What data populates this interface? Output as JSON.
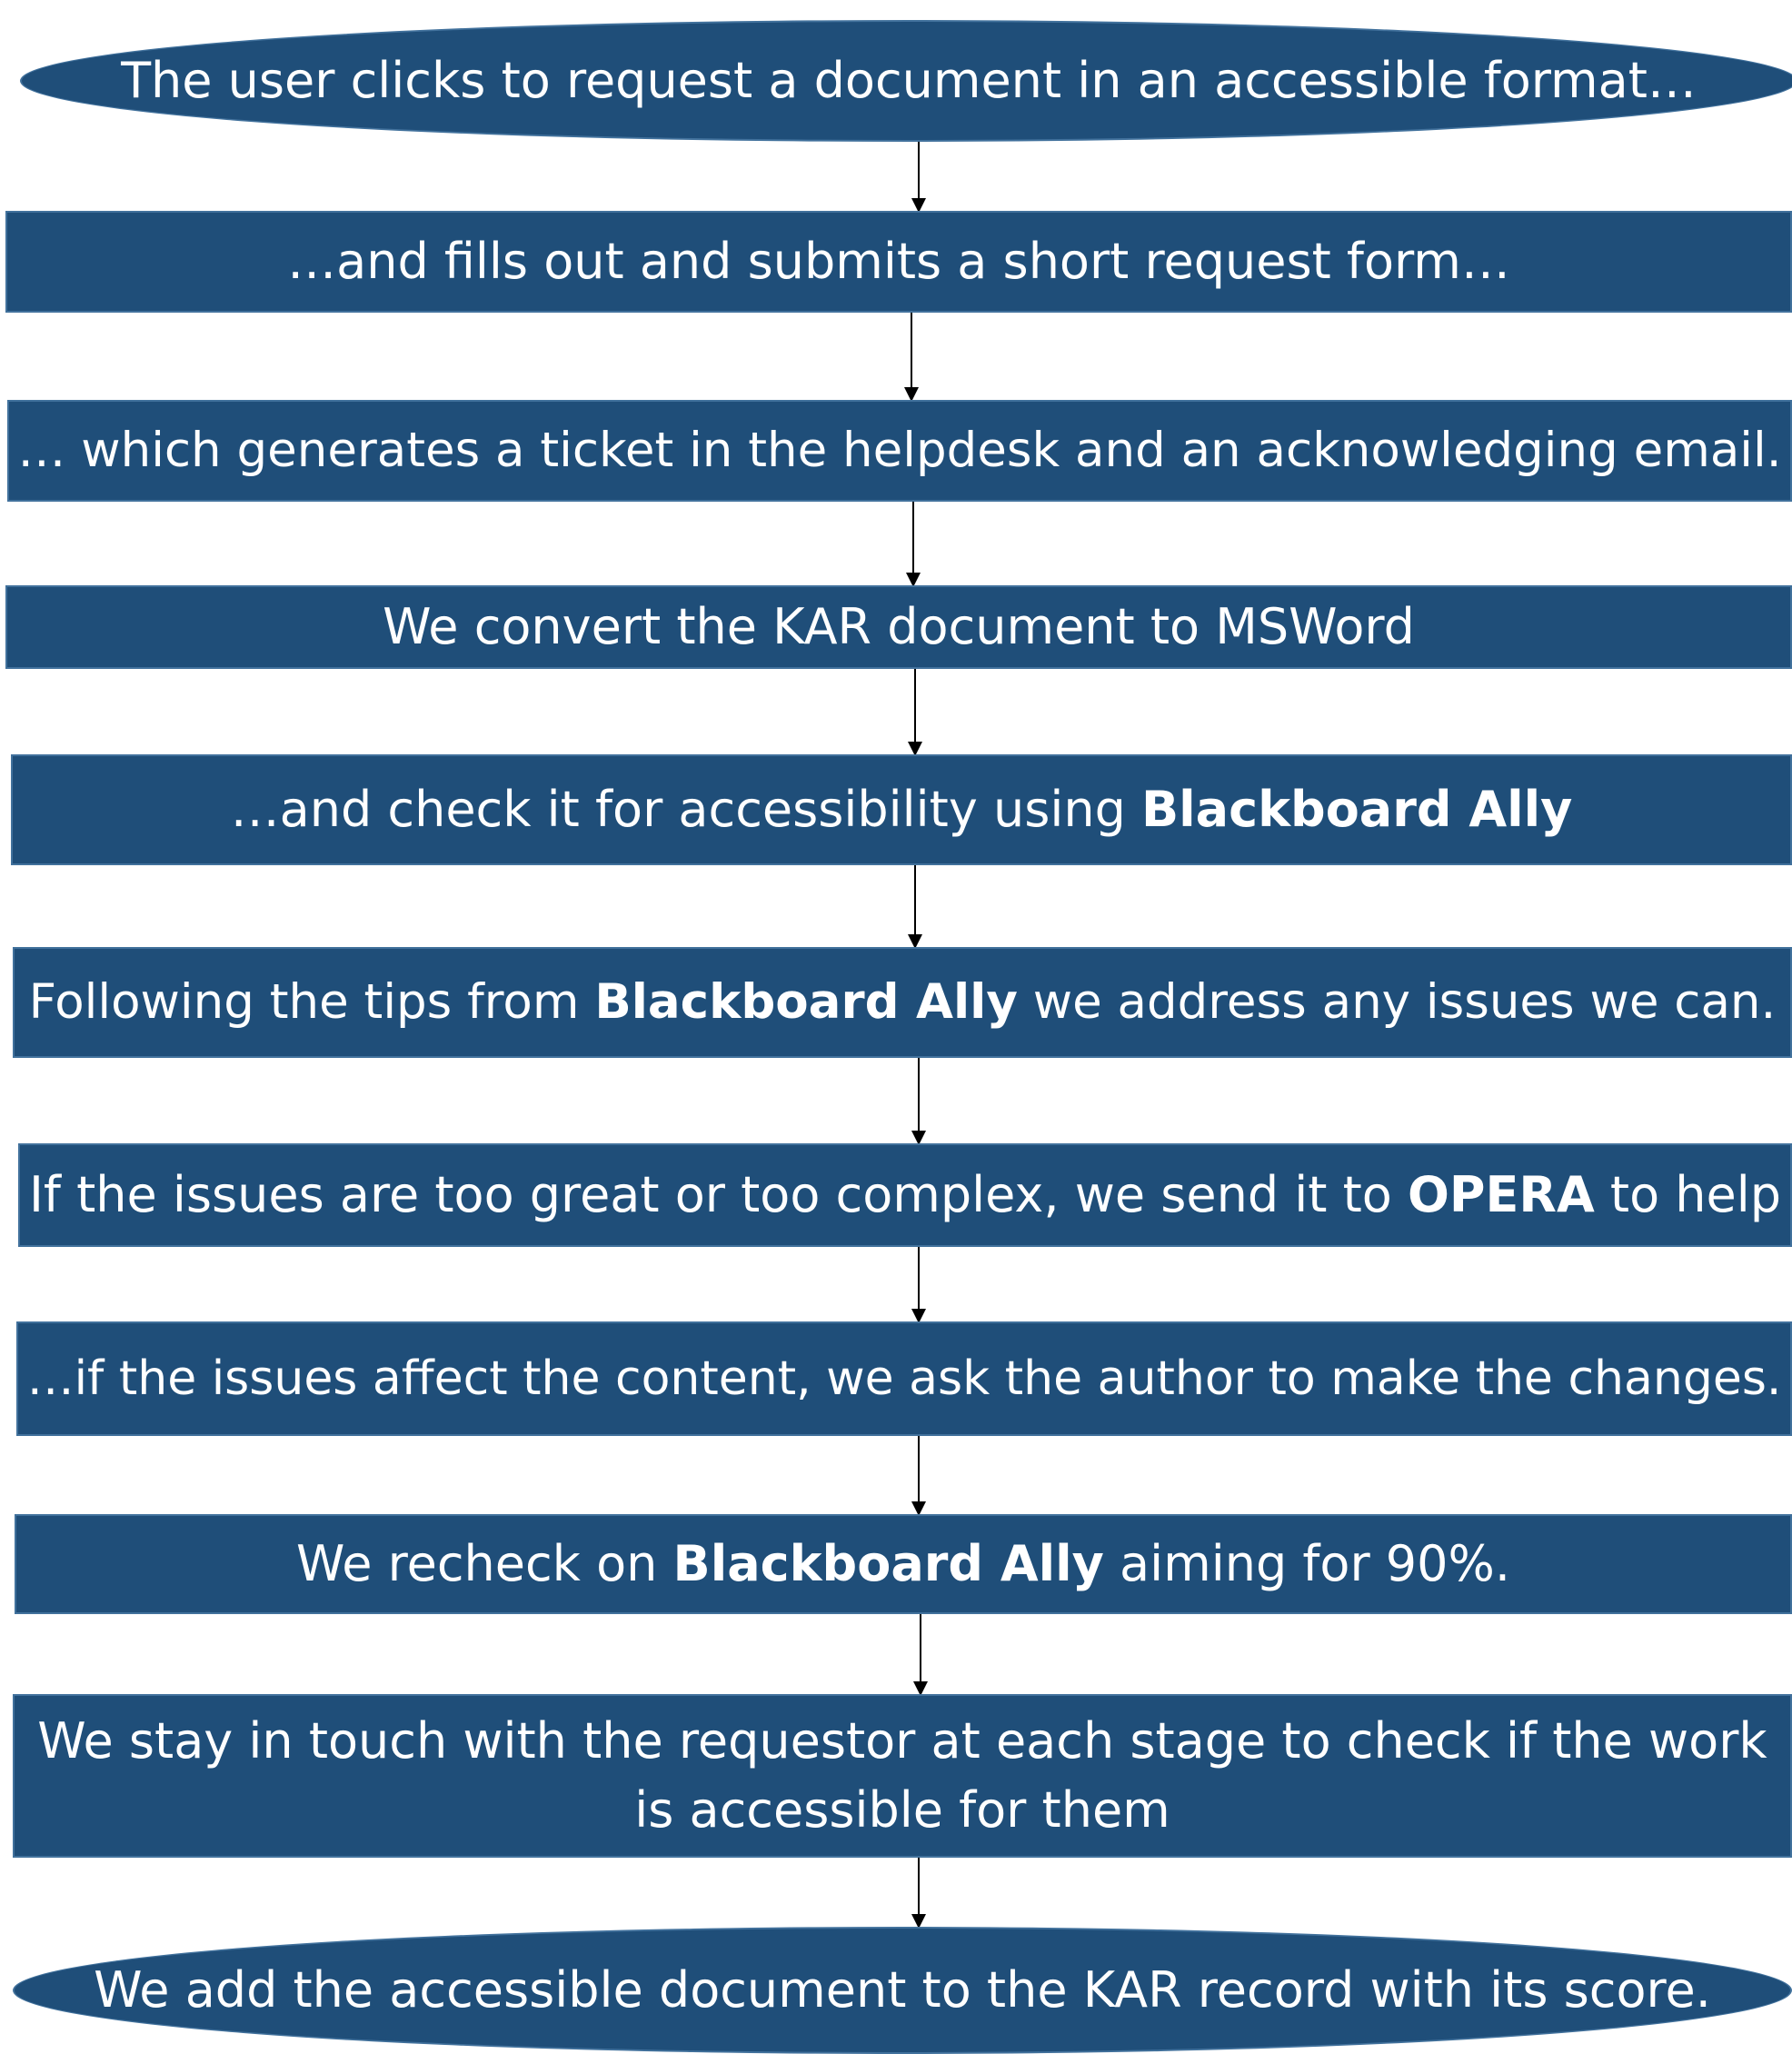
{
  "steps": [
    {
      "id": "request-click",
      "shape": "ellipse",
      "parts": [
        {
          "text": "The user clicks to request a document in an accessible format…",
          "bold": false
        }
      ]
    },
    {
      "id": "fill-form",
      "shape": "rect",
      "parts": [
        {
          "text": "…and fills out and submits a short request form…",
          "bold": false
        }
      ]
    },
    {
      "id": "ticket-email",
      "shape": "rect",
      "parts": [
        {
          "text": "… which generates a ticket in the helpdesk and an acknowledging email.",
          "bold": false
        }
      ]
    },
    {
      "id": "convert-msword",
      "shape": "rect",
      "parts": [
        {
          "text": "We convert the KAR document to MSWord",
          "bold": false
        }
      ]
    },
    {
      "id": "check-ally",
      "shape": "rect",
      "parts": [
        {
          "text": "…and check it for accessibility using ",
          "bold": false
        },
        {
          "text": "Blackboard Ally",
          "bold": true
        }
      ]
    },
    {
      "id": "follow-tips",
      "shape": "rect",
      "parts": [
        {
          "text": "Following the tips from ",
          "bold": false
        },
        {
          "text": "Blackboard Ally",
          "bold": true
        },
        {
          "text": " we address any issues we can.",
          "bold": false
        }
      ]
    },
    {
      "id": "send-opera",
      "shape": "rect",
      "parts": [
        {
          "text": "If the issues are too great or too complex, we send it to ",
          "bold": false
        },
        {
          "text": "OPERA",
          "bold": true
        },
        {
          "text": " to help",
          "bold": false
        }
      ]
    },
    {
      "id": "ask-author",
      "shape": "rect",
      "parts": [
        {
          "text": "…if the issues affect the content, we ask the author to make the changes.",
          "bold": false
        }
      ]
    },
    {
      "id": "recheck-ally",
      "shape": "rect",
      "parts": [
        {
          "text": "We recheck on ",
          "bold": false
        },
        {
          "text": "Blackboard Ally",
          "bold": true
        },
        {
          "text": " aiming for 90%.",
          "bold": false
        }
      ]
    },
    {
      "id": "stay-in-touch",
      "shape": "rect",
      "parts": [
        {
          "text": "We stay in touch with the requestor at each stage to check if the work is accessible for them",
          "bold": false
        }
      ]
    },
    {
      "id": "add-to-kar",
      "shape": "ellipse",
      "parts": [
        {
          "text": "We add the accessible document to the KAR record with its score.",
          "bold": false
        }
      ]
    }
  ],
  "colors": {
    "node_fill": "#1f4e79",
    "node_border": "#41719c",
    "node_text": "#ffffff",
    "arrow": "#000000",
    "background": "#ffffff"
  }
}
